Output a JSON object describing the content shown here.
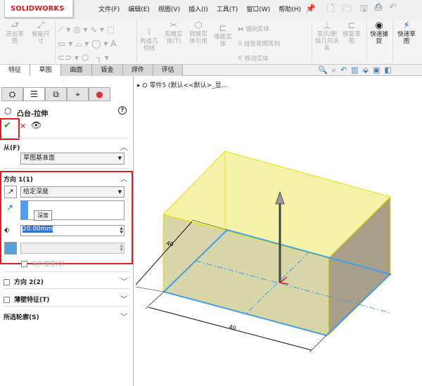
{
  "app": {
    "logo": "SOLIDWORKS"
  },
  "menu": [
    "文件(F)",
    "编辑(E)",
    "视图(V)",
    "插入(I)",
    "工具(T)",
    "窗口(W)",
    "帮助(H)"
  ],
  "ribbon": {
    "exit_sketch": "退出草图",
    "smart_dim": "智能尺寸",
    "construct": "构造几何线",
    "trim": "剪裁实体(T)",
    "convert": "转换实体引用",
    "offset": "等距实体",
    "mirror": "镜向实体",
    "linear_pattern": "线性草图阵列",
    "move": "移动实体",
    "show_relations": "显示/删除几何关系",
    "repair": "修复草图",
    "quick_snap": "快速捕捉",
    "quick_sketch": "快速草图"
  },
  "tabs": [
    "特征",
    "草图",
    "曲面",
    "钣金",
    "焊件",
    "评估"
  ],
  "tree": {
    "part": "零件5 (默认<<默认>_显..."
  },
  "feature": {
    "title": "凸台-拉伸",
    "help": "?",
    "from": {
      "label": "从(F)",
      "value": "草图基准面"
    },
    "dir1": {
      "label": "方向 1(1)",
      "end": "给定深度",
      "tooltip": "深度",
      "depth": "20.00mm",
      "draft": "向外拔模(O)"
    },
    "dir2": "方向 2(2)",
    "thin": "薄壁特征(T)",
    "contours": "所选轮廓(S)"
  },
  "dims": {
    "bottom": "40",
    "left": "40"
  },
  "colors": {
    "accent": "#e02020",
    "sketch": "#3ea0f0",
    "face": "#f2f0b0"
  }
}
